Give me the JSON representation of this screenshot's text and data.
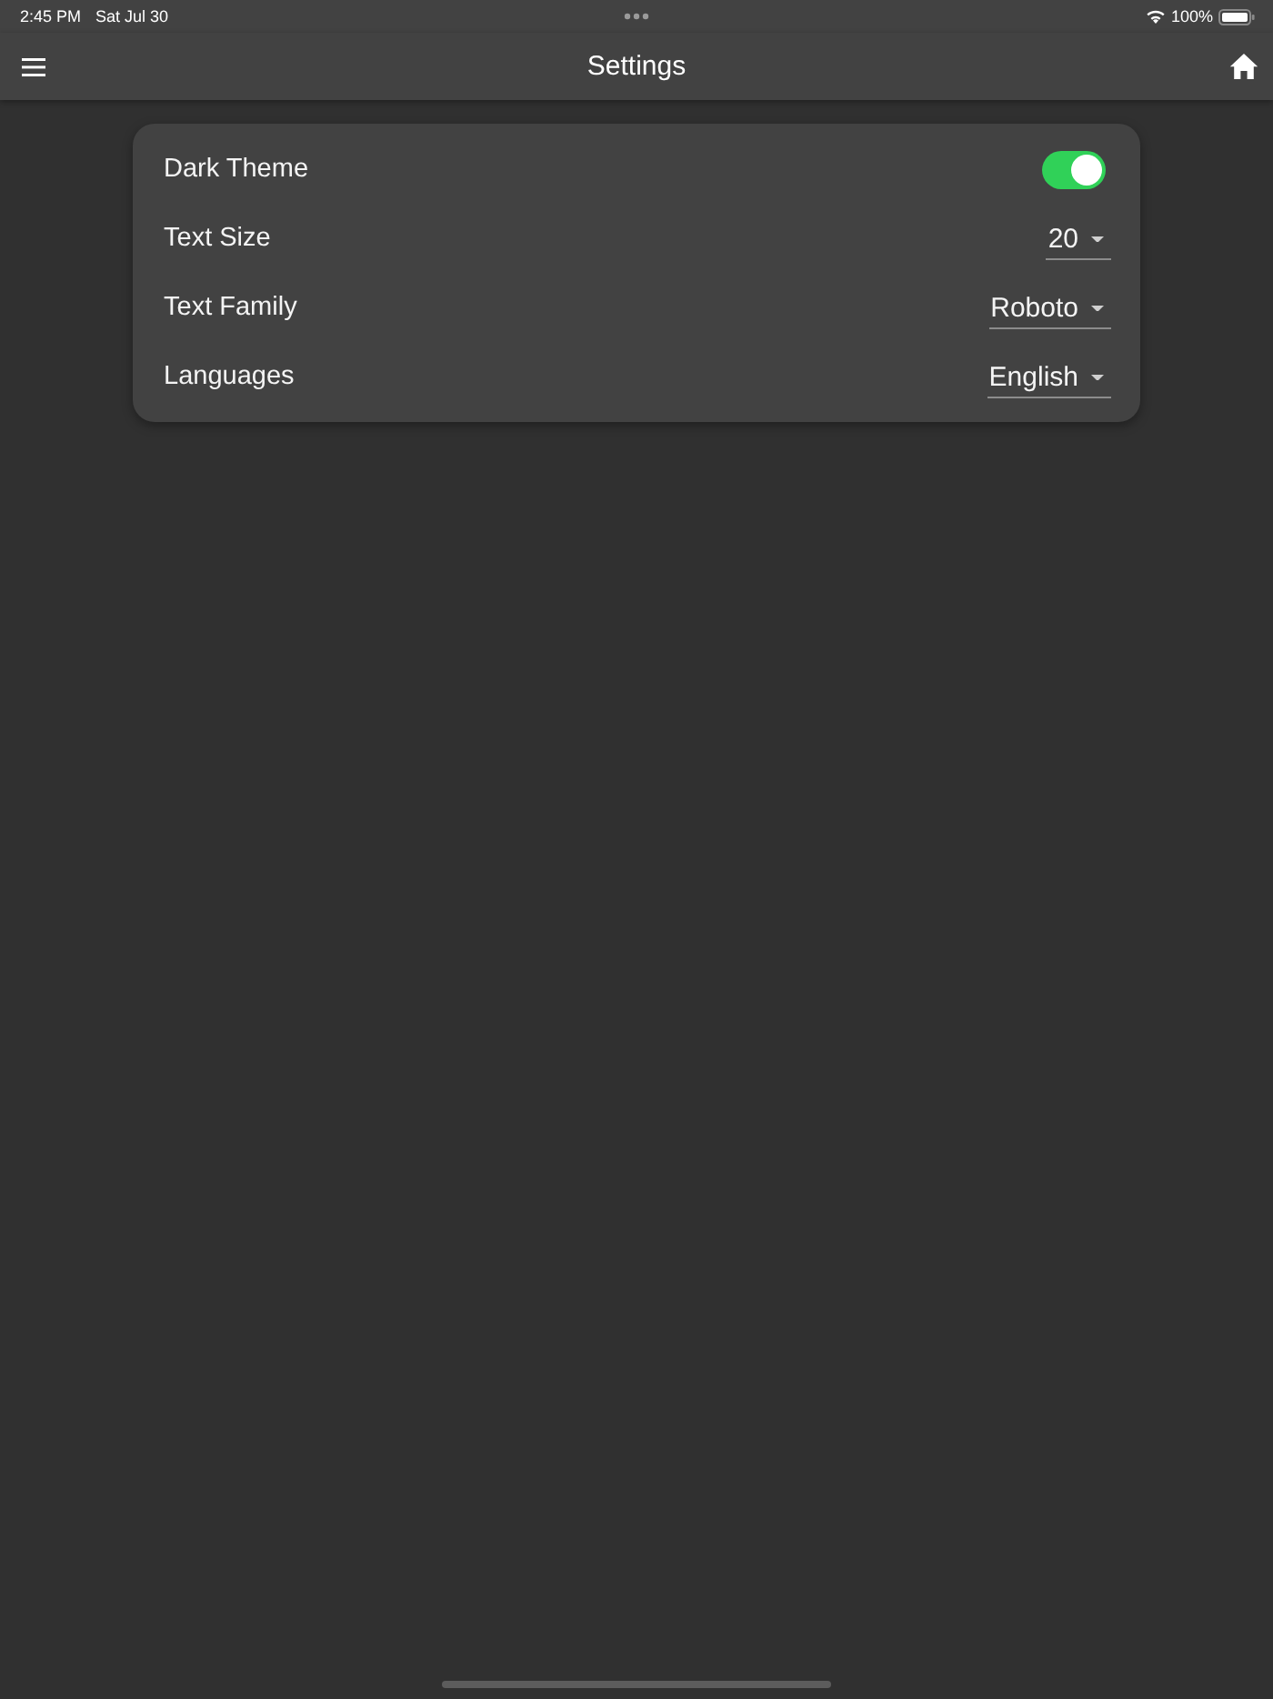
{
  "status_bar": {
    "time": "2:45 PM",
    "date": "Sat Jul 30",
    "battery": "100%"
  },
  "app_bar": {
    "title": "Settings"
  },
  "settings": [
    {
      "kind": "switch",
      "label": "Dark Theme",
      "on": true
    },
    {
      "kind": "dropdown",
      "label": "Text Size",
      "value": "20"
    },
    {
      "kind": "dropdown",
      "label": "Text Family",
      "value": "Roboto"
    },
    {
      "kind": "dropdown",
      "label": "Languages",
      "value": "English"
    }
  ]
}
